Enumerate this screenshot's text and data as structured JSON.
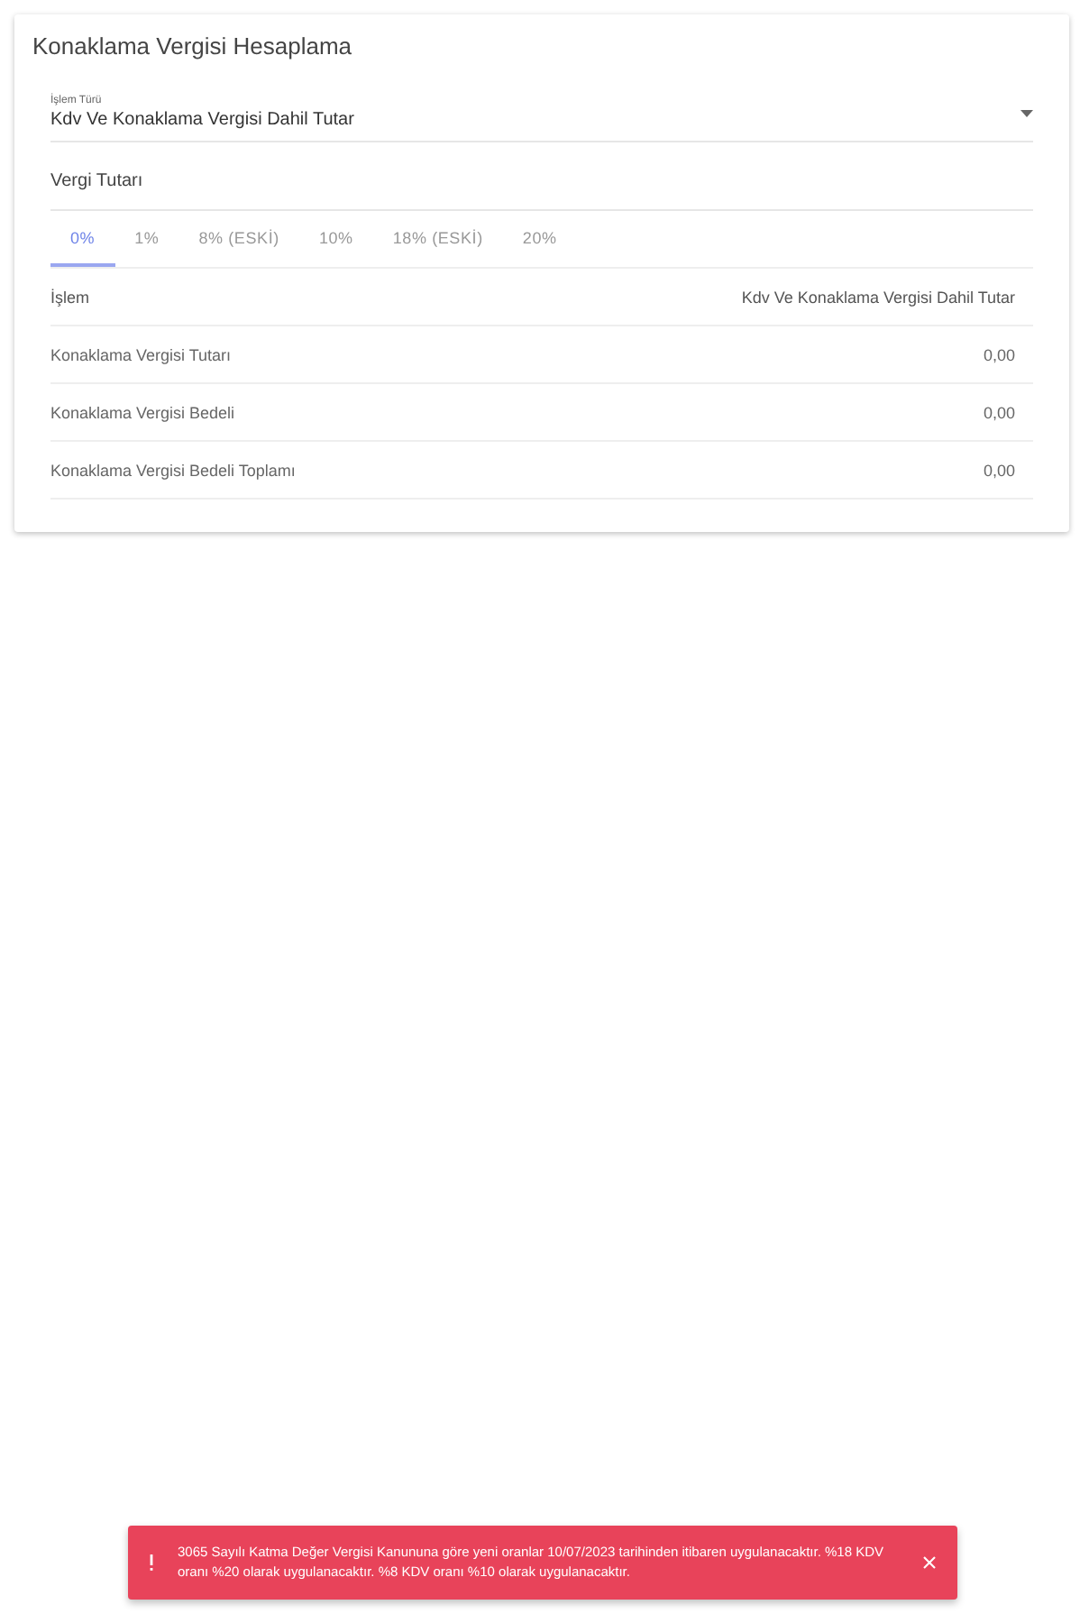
{
  "card": {
    "title": "Konaklama Vergisi Hesaplama"
  },
  "type_select": {
    "label": "İşlem Türü",
    "value": "Kdv Ve Konaklama Vergisi Dahil Tutar"
  },
  "amount_field": {
    "placeholder": "Vergi Tutarı"
  },
  "tabs": [
    {
      "label": "0%",
      "selected": true
    },
    {
      "label": "1%",
      "selected": false
    },
    {
      "label": "8% (ESKİ)",
      "selected": false
    },
    {
      "label": "10%",
      "selected": false
    },
    {
      "label": "18% (ESKİ)",
      "selected": false
    },
    {
      "label": "20%",
      "selected": false
    }
  ],
  "table": {
    "columns": [
      "İşlem",
      "Kdv Ve Konaklama Vergisi Dahil Tutar"
    ],
    "rows": [
      [
        "Konaklama Vergisi Tutarı",
        "0,00"
      ],
      [
        "Konaklama Vergisi Bedeli",
        "0,00"
      ],
      [
        "Konaklama Vergisi Bedeli Toplamı",
        "0,00"
      ]
    ]
  },
  "snackbar": {
    "message": "3065 Sayılı Katma Değer Vergisi Kanununa göre yeni oranlar 10/07/2023 tarihinden itibaren uygulanacaktır. %18 KDV oranı %20 olarak uygulanacaktır. %8 KDV oranı %10 olarak uygulanacaktır."
  }
}
